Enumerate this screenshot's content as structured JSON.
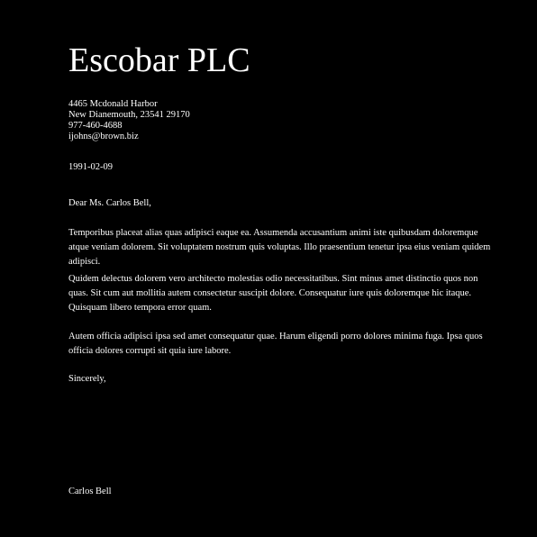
{
  "letter": {
    "company": "Escobar PLC",
    "address": {
      "street": "4465 Mcdonald Harbor",
      "city_line": "New Dianemouth, 23541 29170",
      "phone": "977-460-4688",
      "email": "ijohns@brown.biz"
    },
    "date": "1991-02-09",
    "salutation": "Dear Ms. Carlos Bell,",
    "paragraphs": [
      "Temporibus placeat alias quas adipisci eaque ea. Assumenda accusantium animi iste quibusdam doloremque atque veniam dolorem. Sit voluptatem nostrum quis voluptas. Illo praesentium tenetur ipsa eius veniam quidem adipisci.",
      "Quidem delectus dolorem vero architecto molestias odio necessitatibus. Sint minus amet distinctio quos non quas. Sit cum aut mollitia autem consectetur suscipit dolore. Consequatur iure quis doloremque hic itaque. Quisquam libero tempora error quam.",
      "Autem officia adipisci ipsa sed amet consequatur quae. Harum eligendi porro dolores minima fuga. Ipsa quos officia dolores corrupti sit quia iure labore."
    ],
    "closing": "Sincerely,",
    "signature": "Carlos Bell"
  }
}
